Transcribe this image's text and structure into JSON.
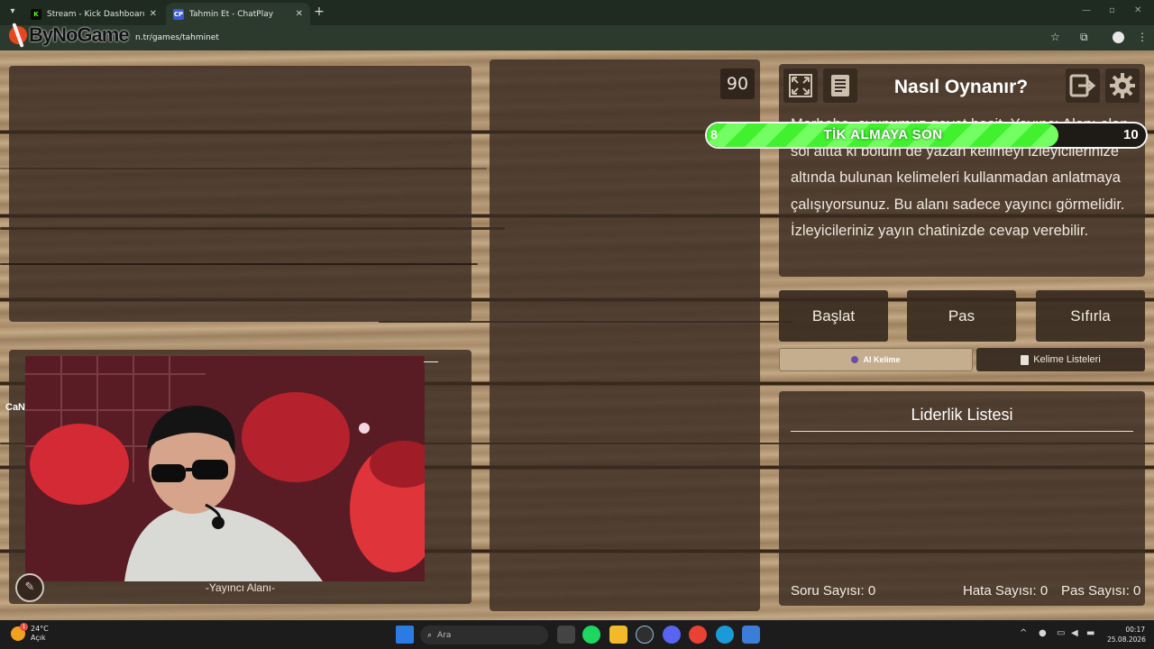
{
  "browser": {
    "tabs": [
      {
        "favicon": "K",
        "title": "Stream - Kick Dashboard",
        "color": "#53fc18"
      },
      {
        "favicon": "CP",
        "title": "Tahmin Et - ChatPlay",
        "color": "#3a5bd9"
      }
    ],
    "url_muted": "",
    "url": "n.tr/games/tahminet",
    "logo_text": "ByNoGame"
  },
  "game": {
    "timer": "90",
    "howto_title": "Nasıl Oynanır?",
    "howto_text": "Merhaba, oyunumuz gayet basit. Yayıncı Alanı olan sol altta ki bölüm de yazan kelimeyi izleyicilerinize altında bulunan kelimeleri kullanmadan anlatmaya çalışıyorsunuz. Bu alanı sadece yayıncı görmelidir. İzleyicileriniz yayın chatinizde cevap verebilir.",
    "progress": {
      "label": "TİK ALMAYA SON",
      "current": "8",
      "target": "10",
      "fraction": 0.8
    },
    "buttons": {
      "start": "Başlat",
      "pass": "Pas",
      "reset": "Sıfırla",
      "ai_word": "AI Kelime",
      "word_lists": "Kelime Listeleri"
    },
    "leaderboard_title": "Liderlik Listesi",
    "stats": {
      "questions": "Soru Sayısı: 0",
      "errors": "Hata Sayısı: 0",
      "passes": "Pas Sayısı: 0"
    },
    "streamer_area": "-Yayıncı Alanı-",
    "cam_label": "CaN"
  },
  "taskbar": {
    "weather_temp": "24°C",
    "weather_desc": "Açık",
    "search_placeholder": "Ara",
    "time": "00:17",
    "date": "25.08.2026"
  },
  "colors": {
    "progress_green": "#41f12e",
    "panel_dark": "#3a2c22",
    "wood_light": "#b69a78"
  }
}
